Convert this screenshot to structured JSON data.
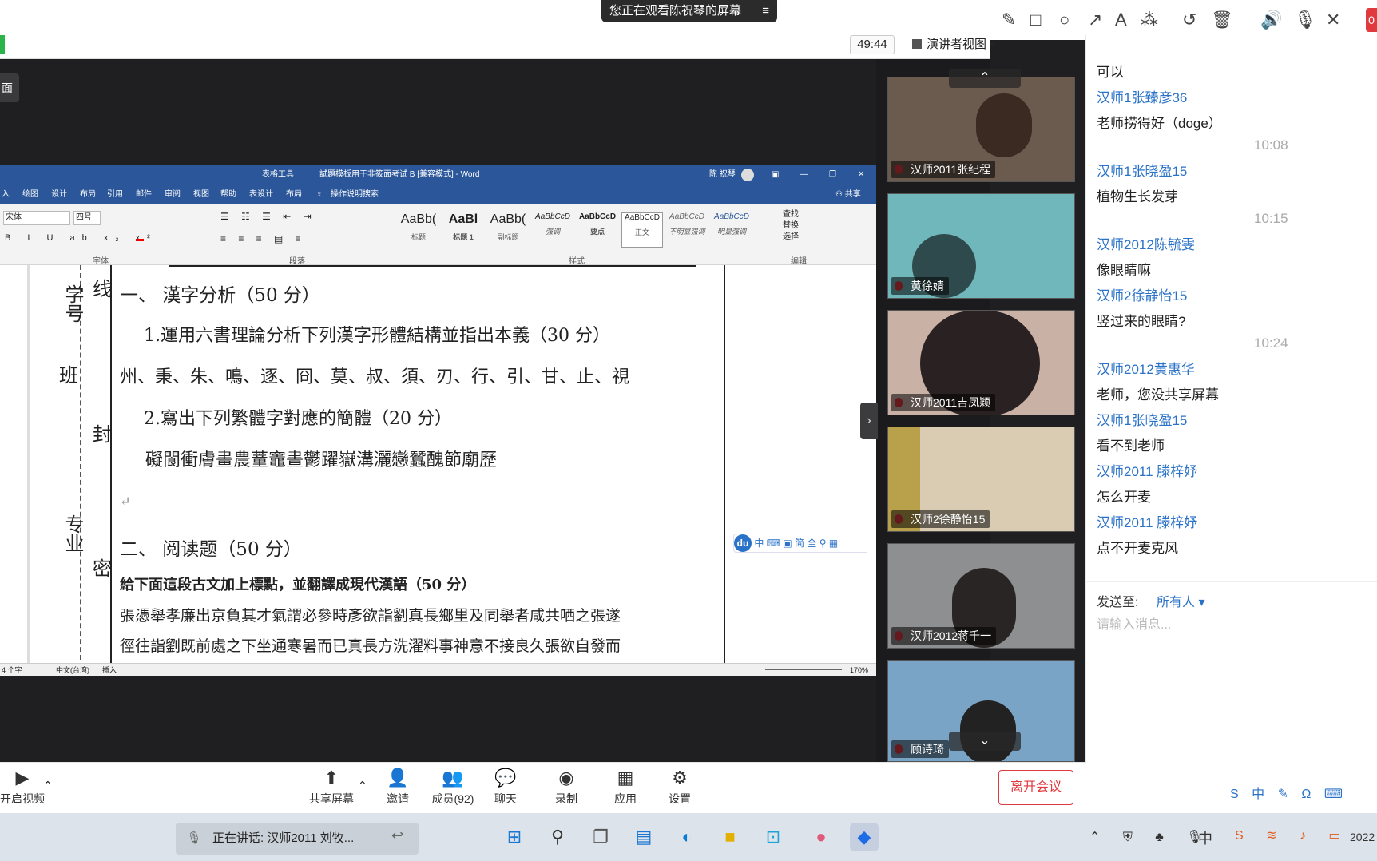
{
  "banner": {
    "viewing": "您正在观看陈祝琴的屏幕",
    "menu_icon": "≡"
  },
  "toolbar": {
    "timer": "49:44",
    "presenter_view": "演讲者视图",
    "chat": "聊天"
  },
  "side_label": "面",
  "word": {
    "title": "試題模板用于非筱面考试 B [兼容模式] - Word",
    "table_tools": "表格工具",
    "user": "陈 祝琴",
    "tabs": [
      "入",
      "绘图",
      "设计",
      "布局",
      "引用",
      "邮件",
      "审阅",
      "视图",
      "帮助",
      "表设计",
      "布局"
    ],
    "tell_me": "操作说明搜索",
    "share": "共享",
    "font_name": "宋体",
    "font_size": "四号",
    "styles": [
      {
        "sample": "AaBb(",
        "name": "标题"
      },
      {
        "sample": "AaBl",
        "name": "标题 1"
      },
      {
        "sample": "AaBb(",
        "name": "副标题"
      },
      {
        "sample": "AaBbCcD",
        "name": "强调"
      },
      {
        "sample": "AaBbCcD",
        "name": "要点"
      },
      {
        "sample": "AaBbCcD",
        "name": "正文"
      },
      {
        "sample": "AaBbCcD",
        "name": "不明显强调"
      },
      {
        "sample": "AaBbCcD",
        "name": "明显强调"
      }
    ],
    "editing": [
      "查找",
      "替换",
      "选择"
    ],
    "groups": [
      "字体",
      "段落",
      "样式",
      "编辑"
    ],
    "margin_labels": [
      "学号",
      "线",
      "班",
      "封",
      "专业",
      "密"
    ],
    "doc": {
      "h1": "一、  漢字分析（50 分）",
      "q1": "1.運用六書理論分析下列漢字形體結構並指出本義（30 分）",
      "q1_chars": "州、秉、朱、鳴、逐、冏、莫、叔、須、刃、行、引、甘、止、視",
      "q2": "2.寫出下列繁體字對應的簡體（20 分）",
      "q2_chars": "礙閬衝膚畫農蕫竈晝鬱躍嶽溝灑戀蠶醜節廟歷",
      "h2": "二、  阅读题（50 分）",
      "q3": "給下面這段古文加上標點，並翻譯成現代漢語（50 分）",
      "p1": "張憑舉孝廉出京負其才氣謂必參時彥欲詣劉真長鄉里及同舉者咸共哂之張遂",
      "p2": "徑往詣劉既前處之下坐通寒暑而已真長方洗濯料事神意不接良久張欲自發而"
    },
    "status": {
      "words": "4 个字",
      "lang": "中文(台湾)",
      "mode": "插入",
      "zoom": "170%"
    },
    "ime": [
      "du",
      "中",
      "简",
      "全"
    ]
  },
  "participants": [
    {
      "name": "汉师2011张纪程"
    },
    {
      "name": "黄徐婧"
    },
    {
      "name": "汉师2011吉凤颖"
    },
    {
      "name": "汉师2徐静怡15"
    },
    {
      "name": "汉师2012蒋千一"
    },
    {
      "name": "顾诗琦"
    }
  ],
  "chat": {
    "messages": [
      {
        "type": "text",
        "text": "可以"
      },
      {
        "type": "name",
        "text": "汉师1张臻彦36"
      },
      {
        "type": "text",
        "text": "老师捞得好（doge）"
      },
      {
        "type": "time",
        "text": "10:08"
      },
      {
        "type": "name",
        "text": "汉师1张晓盈15"
      },
      {
        "type": "text",
        "text": "植物生长发芽"
      },
      {
        "type": "time",
        "text": "10:15"
      },
      {
        "type": "name",
        "text": "汉师2012陈毓雯"
      },
      {
        "type": "text",
        "text": "像眼睛嘛"
      },
      {
        "type": "name",
        "text": "汉师2徐静怡15"
      },
      {
        "type": "text",
        "text": "竖过来的眼睛?"
      },
      {
        "type": "time",
        "text": "10:24"
      },
      {
        "type": "name",
        "text": "汉师2012黄惠华"
      },
      {
        "type": "text",
        "text": "老师，您没共享屏幕"
      },
      {
        "type": "name",
        "text": "汉师1张晓盈15"
      },
      {
        "type": "text",
        "text": "看不到老师"
      },
      {
        "type": "name",
        "text": "汉师2011 滕梓妤"
      },
      {
        "type": "text",
        "text": "怎么开麦"
      },
      {
        "type": "name",
        "text": "汉师2011 滕梓妤"
      },
      {
        "type": "text",
        "text": "点不开麦克风"
      }
    ],
    "send_to_label": "发送至:",
    "send_to_value": "所有人",
    "placeholder": "请输入消息..."
  },
  "bottombar": {
    "video": "开启视频",
    "share": "共享屏幕",
    "invite": "邀请",
    "members": "成员(92)",
    "chat": "聊天",
    "record": "录制",
    "apps": "应用",
    "settings": "设置",
    "leave": "离开会议"
  },
  "taskbar": {
    "speaking": "正在讲话: 汉师2011 刘牧...",
    "ime": "中",
    "clock": "2022"
  },
  "colors": {
    "accent": "#2a72c8",
    "word_blue": "#2b579a",
    "leave_red": "#e0393e"
  }
}
